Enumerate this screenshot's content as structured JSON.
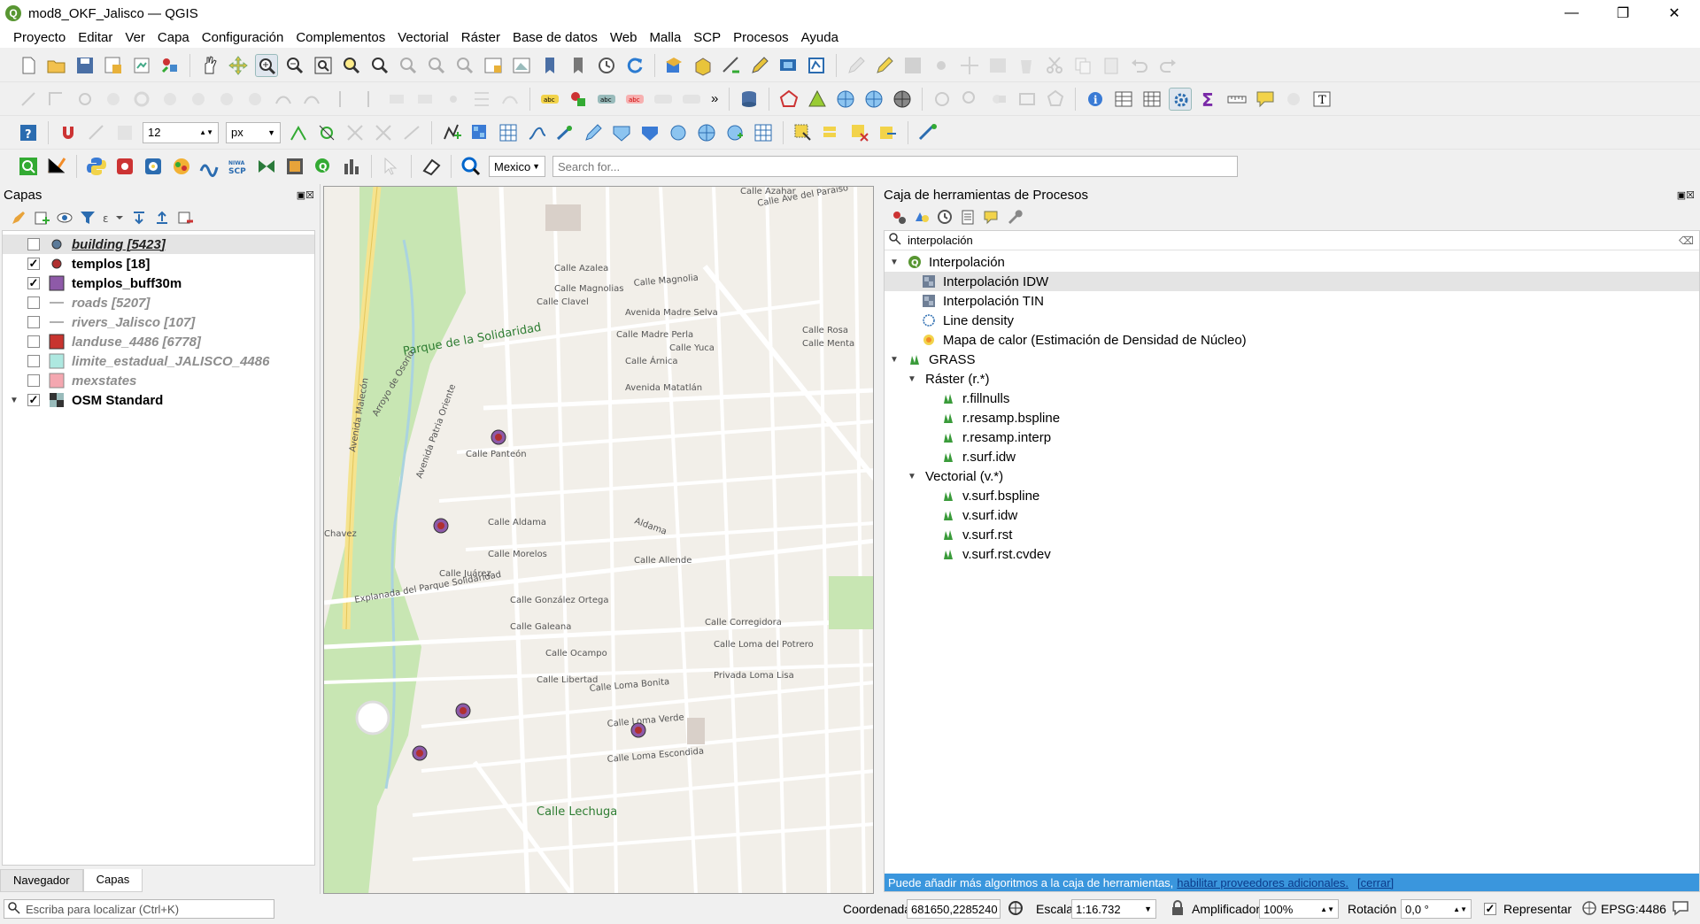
{
  "window": {
    "title": "mod8_OKF_Jalisco — QGIS",
    "minimize": "—",
    "restore": "❐",
    "close": "✕"
  },
  "menu": [
    "Proyecto",
    "Editar",
    "Ver",
    "Capa",
    "Configuración",
    "Complementos",
    "Vectorial",
    "Ráster",
    "Base de datos",
    "Web",
    "Malla",
    "SCP",
    "Procesos",
    "Ayuda"
  ],
  "toolbar3": {
    "size_value": "12",
    "unit": "px"
  },
  "toolbar4": {
    "locator_scope": "Mexico",
    "search_placeholder": "Search for..."
  },
  "layers_panel": {
    "title": "Capas",
    "layers": [
      {
        "name": "building [5423]",
        "checked": false,
        "style": "gray-underline",
        "color": "#5b7a99"
      },
      {
        "name": "templos [18]",
        "checked": true,
        "style": "bold",
        "color": "#b03030"
      },
      {
        "name": "templos_buff30m",
        "checked": true,
        "style": "bold",
        "color": "#8e5aa8"
      },
      {
        "name": "roads [5207]",
        "checked": false,
        "style": "gray",
        "color": "#b0b0b0"
      },
      {
        "name": "rivers_Jalisco [107]",
        "checked": false,
        "style": "gray",
        "color": "#b0b0b0"
      },
      {
        "name": "landuse_4486 [6778]",
        "checked": false,
        "style": "gray",
        "color": "#c8342f"
      },
      {
        "name": "limite_estadual_JALISCO_4486",
        "checked": false,
        "style": "gray",
        "color": "#aee8e0"
      },
      {
        "name": "mexstates",
        "checked": false,
        "style": "gray",
        "color": "#f4a7b0"
      },
      {
        "name": "OSM Standard",
        "checked": true,
        "style": "bold",
        "color": "#333333"
      }
    ],
    "tabs": [
      "Navegador",
      "Capas"
    ],
    "locator_placeholder": "Escriba para localizar (Ctrl+K)"
  },
  "map": {
    "labels": [
      "Calle Azahar",
      "Calle Ave del Paraíso",
      "Calle Azalea",
      "Calle Magnolias",
      "Calle Clavel",
      "Calle Magnolia",
      "Avenida Madre Selva",
      "Calle Madre Perla",
      "Calle Yuca",
      "Calle Rosa",
      "Calle Menta",
      "Calle Árnica",
      "Avenida Matatlán",
      "Parque de la Solidaridad",
      "Avenida Malecón",
      "Arroyo de Osorio",
      "Avenida Patria Oriente",
      "Calle Panteón",
      "Calle Aldama",
      "Calle Morelos",
      "Calle Juárez",
      "Calle Allende",
      "Calle González Ortega",
      "Calle Galeana",
      "Calle Ocampo",
      "Calle Libertad",
      "Calle Corregidora",
      "Calle Loma del Potrero",
      "Privada Loma Lisa",
      "Calle Loma Bonita",
      "Calle Loma Verde",
      "Calle Loma Escondida",
      "Calle Lechuga",
      "Explanada del Parque Solidaridad",
      "Chavez",
      "Aldama"
    ]
  },
  "processing": {
    "title": "Caja de herramientas de Procesos",
    "search_value": "interpolación",
    "tree": [
      {
        "label": "Interpolación",
        "level": 0,
        "kind": "group-q"
      },
      {
        "label": "Interpolación IDW",
        "level": 1,
        "kind": "raster",
        "selected": true
      },
      {
        "label": "Interpolación TIN",
        "level": 1,
        "kind": "raster"
      },
      {
        "label": "Line density",
        "level": 1,
        "kind": "line"
      },
      {
        "label": "Mapa de calor (Estimación de Densidad de Núcleo)",
        "level": 1,
        "kind": "heat"
      },
      {
        "label": "GRASS",
        "level": 0,
        "kind": "group-grass"
      },
      {
        "label": "Ráster (r.*)",
        "level": 1,
        "kind": "sub"
      },
      {
        "label": "r.fillnulls",
        "level": 2,
        "kind": "grass"
      },
      {
        "label": "r.resamp.bspline",
        "level": 2,
        "kind": "grass"
      },
      {
        "label": "r.resamp.interp",
        "level": 2,
        "kind": "grass"
      },
      {
        "label": "r.surf.idw",
        "level": 2,
        "kind": "grass"
      },
      {
        "label": "Vectorial (v.*)",
        "level": 1,
        "kind": "sub"
      },
      {
        "label": "v.surf.bspline",
        "level": 2,
        "kind": "grass"
      },
      {
        "label": "v.surf.idw",
        "level": 2,
        "kind": "grass"
      },
      {
        "label": "v.surf.rst",
        "level": 2,
        "kind": "grass"
      },
      {
        "label": "v.surf.rst.cvdev",
        "level": 2,
        "kind": "grass"
      }
    ],
    "info_text": "Puede añadir más algoritmos a la caja de herramientas,",
    "info_link": "habilitar proveedores adicionales.",
    "info_close": "[cerrar]"
  },
  "status": {
    "coord_label": "Coordenada",
    "coord_value": "681650,2285240",
    "scale_label": "Escala",
    "scale_value": "1:16.732",
    "magnifier_label": "Amplificador",
    "magnifier_value": "100%",
    "rotation_label": "Rotación",
    "rotation_value": "0,0 °",
    "render_label": "Representar",
    "crs": "EPSG:4486"
  },
  "colors": {
    "accent": "#589632",
    "selection": "#cde8ff",
    "info_bg": "#3a96dd"
  }
}
